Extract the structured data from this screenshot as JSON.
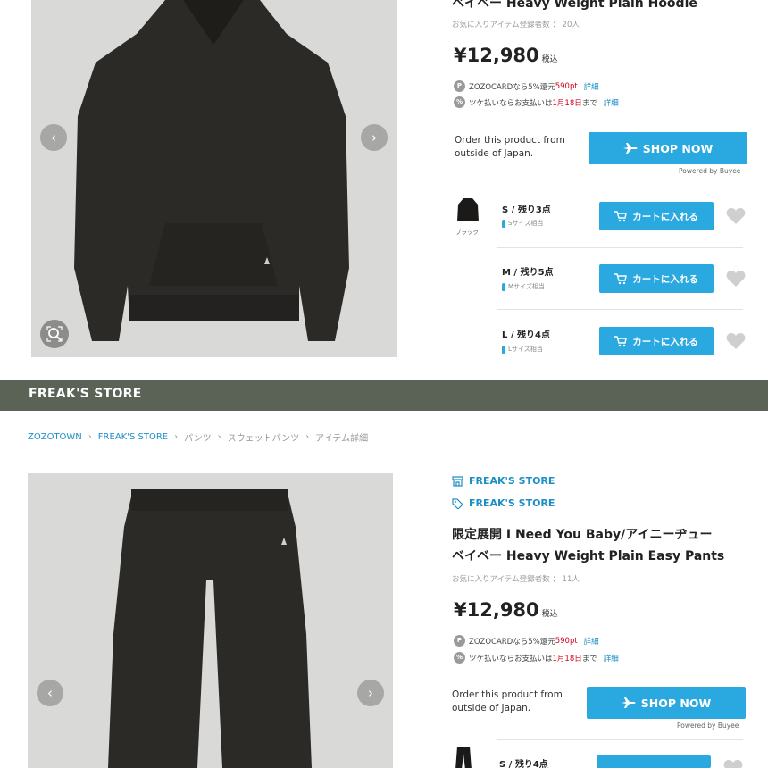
{
  "product1": {
    "title_line": "ベイベー Heavy Weight Plain Hoodie",
    "fav_count": "お気に入りアイテム登録者数 ： 20人",
    "price": "¥12,980",
    "tax_label": "税込",
    "promo_card": {
      "badge": "P",
      "prefix": "ZOZOCARDなら5%還元",
      "points": "590pt",
      "link": "詳細"
    },
    "promo_tsuke": {
      "badge": "%",
      "prefix": "ツケ払いならお支払いは",
      "date": "1月18日",
      "suffix": "まで",
      "link": "詳細"
    },
    "order_text": "Order this product from outside of Japan.",
    "shop_now": "SHOP NOW",
    "powered_by": "Powered by Buyee",
    "thumb_caption": "ブラック",
    "sizes": [
      {
        "label": "S / 残り3点",
        "sub": "Sサイズ相当",
        "cart": "カートに入れる"
      },
      {
        "label": "M / 残り5点",
        "sub": "Mサイズ相当",
        "cart": "カートに入れる"
      },
      {
        "label": "L / 残り4点",
        "sub": "Lサイズ相当",
        "cart": "カートに入れる"
      }
    ]
  },
  "store_banner": "FREAK'S STORE",
  "breadcrumb": [
    "ZOZOTOWN",
    "FREAK'S STORE",
    "パンツ",
    "スウェットパンツ",
    "アイテム詳細"
  ],
  "product2": {
    "shop_name": "FREAK'S STORE",
    "brand_name": "FREAK'S STORE",
    "title_line1": "限定展開 I Need You Baby/アイニーヂュー",
    "title_line2": "ベイベー Heavy Weight Plain Easy Pants",
    "fav_count": "お気に入りアイテム登録者数 ： 11人",
    "price": "¥12,980",
    "tax_label": "税込",
    "promo_card": {
      "badge": "P",
      "prefix": "ZOZOCARDなら5%還元",
      "points": "590pt",
      "link": "詳細"
    },
    "promo_tsuke": {
      "badge": "%",
      "prefix": "ツケ払いならお支払いは",
      "date": "1月18日",
      "suffix": "まで",
      "link": "詳細"
    },
    "order_text": "Order this product from outside of Japan.",
    "shop_now": "SHOP NOW",
    "powered_by": "Powered by Buyee",
    "sizes": [
      {
        "label": "S / 残り4点"
      }
    ]
  },
  "colors": {
    "accent": "#2aa8e0",
    "link": "#1e8fc6",
    "banner": "#5b6357",
    "garment": "#2c2a26",
    "photo_bg": "#d9d9d7"
  }
}
